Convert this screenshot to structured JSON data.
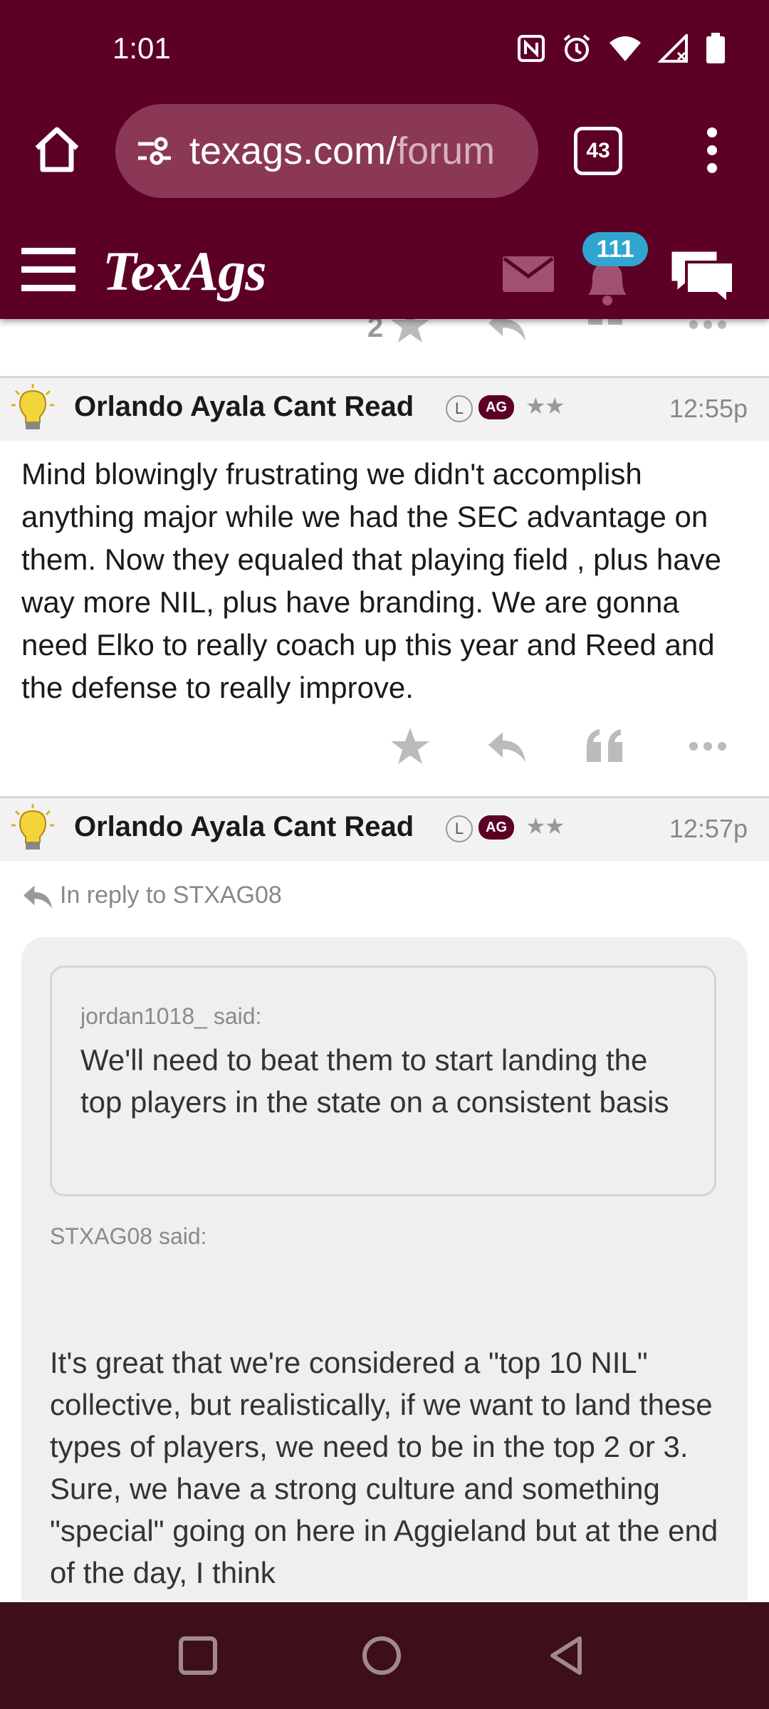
{
  "status_bar": {
    "time": "1:01"
  },
  "browser": {
    "url_main": "texags.com/",
    "url_dim": "forum",
    "tab_count": "43"
  },
  "site": {
    "logo": "TexAgs",
    "notification_count": "111"
  },
  "prev_post_actions": {
    "star_count": "2"
  },
  "posts": [
    {
      "username": "Orlando Ayala Cant Read",
      "badge_l": "L",
      "badge_ag": "AG",
      "stars": "★★",
      "time": "12:55p",
      "body": "Mind blowingly frustrating we didn't accomplish anything major while we had the SEC advantage on them. Now they equaled that playing field , plus have way more NIL, plus have branding. We are gonna need Elko to really coach up this year and Reed and the defense to really improve."
    },
    {
      "username": "Orlando Ayala Cant Read",
      "badge_l": "L",
      "badge_ag": "AG",
      "stars": "★★",
      "time": "12:57p",
      "reply_to": "In reply to STXAG08",
      "inner_quote_author": "jordan1018_ said:",
      "inner_quote_text": "We'll need to beat them to start landing the top players in the state on a consistent basis",
      "quote_author": "STXAG08 said:",
      "quote_text": "It's great that we're considered a \"top 10 NIL\" collective, but realistically, if we want to land these types of players, we need to be in the top 2 or 3. Sure, we have a strong culture and something \"special\" going on here in Aggieland but at the end of the day, I think"
    }
  ],
  "colors": {
    "maroon": "#5c0025",
    "badge_blue": "#2fa5d0",
    "nav_bg": "#3c0f1b"
  }
}
